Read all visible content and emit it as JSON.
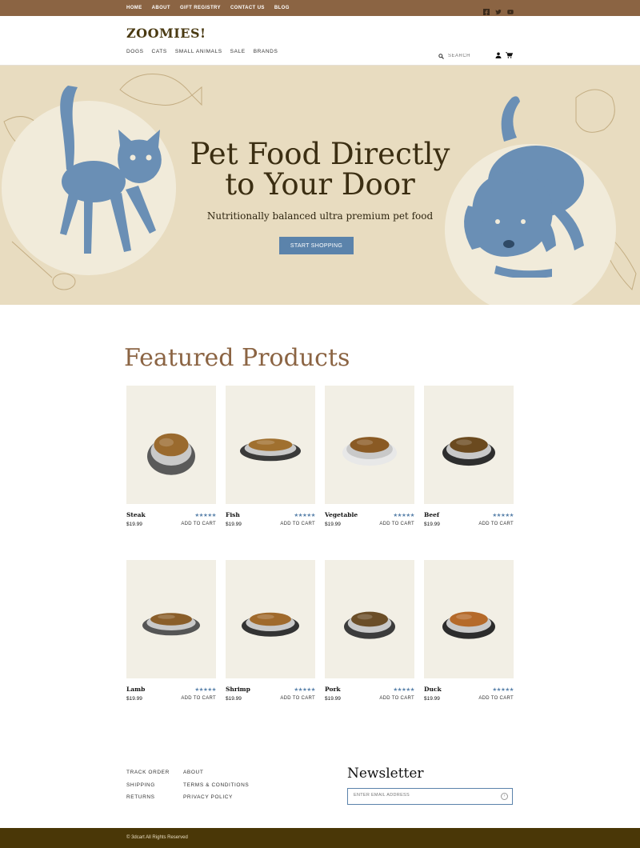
{
  "topbar": {
    "links": [
      "HOME",
      "ABOUT",
      "GIFT REGISTRY",
      "CONTACT US",
      "BLOG"
    ],
    "social_icons": [
      "facebook-icon",
      "twitter-icon",
      "youtube-icon"
    ],
    "color": "#8b6443"
  },
  "header": {
    "logo": "ZOOMIES!",
    "nav": [
      "DOGS",
      "CATS",
      "SMALL ANIMALS",
      "SALE",
      "BRANDS"
    ],
    "search_placeholder": "SEARCH",
    "icons": [
      "user-icon",
      "cart-icon"
    ]
  },
  "hero": {
    "title_line1": "Pet Food Directly",
    "title_line2": "to Your Door",
    "subtitle": "Nutritionally balanced ultra premium pet food",
    "cta": "START SHOPPING",
    "accent": "#5b83ab"
  },
  "featured": {
    "title": "Featured Products",
    "products": [
      {
        "name": "Steak",
        "price": "$19.99",
        "stars": "★★★★★",
        "add": "ADD TO CART"
      },
      {
        "name": "Fish",
        "price": "$19.99",
        "stars": "★★★★★",
        "add": "ADD TO CART"
      },
      {
        "name": "Vegetable",
        "price": "$19.99",
        "stars": "★★★★★",
        "add": "ADD TO CART"
      },
      {
        "name": "Beef",
        "price": "$19.99",
        "stars": "★★★★★",
        "add": "ADD TO CART"
      },
      {
        "name": "Lamb",
        "price": "$19.99",
        "stars": "★★★★★",
        "add": "ADD TO CART"
      },
      {
        "name": "Shrimp",
        "price": "$19.99",
        "stars": "★★★★★",
        "add": "ADD TO CART"
      },
      {
        "name": "Pork",
        "price": "$19.99",
        "stars": "★★★★★",
        "add": "ADD TO CART"
      },
      {
        "name": "Duck",
        "price": "$19.99",
        "stars": "★★★★★",
        "add": "ADD TO CART"
      }
    ]
  },
  "footer": {
    "col1": [
      "TRACK ORDER",
      "SHIPPING",
      "RETURNS"
    ],
    "col2": [
      "ABOUT",
      "TERMS & CONDITIONS",
      "PRIVACY POLICY"
    ],
    "newsletter_title": "Newsletter",
    "email_placeholder": "ENTER EMAIL ADDRESS",
    "copyright": "© 3dcart All Rights Reserved"
  }
}
